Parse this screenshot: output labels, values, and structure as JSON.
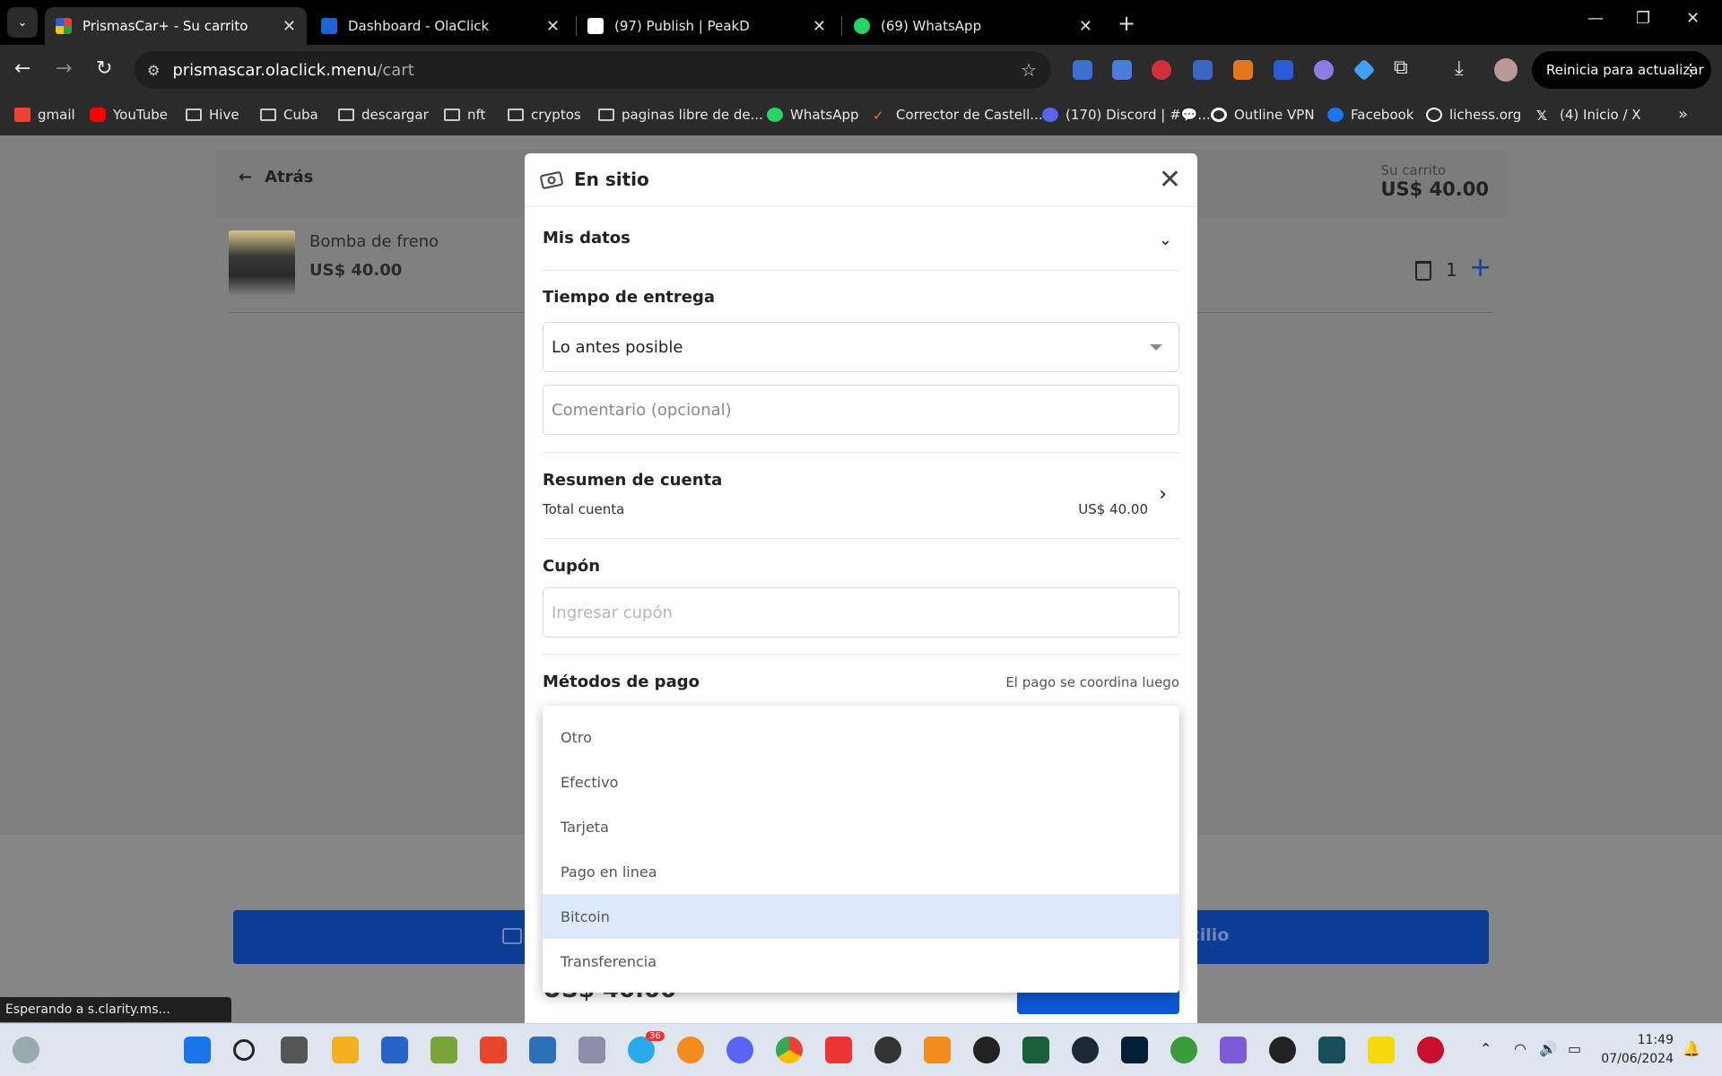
{
  "browser": {
    "tabs": [
      {
        "title": "PrismasCar+ - Su carrito",
        "active": true,
        "favicon_color": "#e0403a"
      },
      {
        "title": "Dashboard - OlaClick",
        "active": false,
        "favicon_color": "#1d64d6"
      },
      {
        "title": "(97) Publish | PeakD",
        "active": false,
        "favicon_color": "#ffffff"
      },
      {
        "title": "(69) WhatsApp",
        "active": false,
        "favicon_color": "#25d366"
      }
    ],
    "url": {
      "host": "prismascar.olaclick.menu",
      "path": "/cart"
    },
    "update_button": "Reinicia para actualizar",
    "bookmarks": [
      {
        "label": "gmail",
        "icon": "gmail-icon",
        "color": "#ea4335"
      },
      {
        "label": "YouTube",
        "icon": "youtube-icon",
        "color": "#ff0000"
      },
      {
        "label": "Hive",
        "icon": "folder-icon"
      },
      {
        "label": "Cuba",
        "icon": "folder-icon"
      },
      {
        "label": "descargar",
        "icon": "folder-icon"
      },
      {
        "label": "nft",
        "icon": "folder-icon"
      },
      {
        "label": "cryptos",
        "icon": "folder-icon"
      },
      {
        "label": "paginas libre de de...",
        "icon": "folder-icon"
      },
      {
        "label": "WhatsApp",
        "icon": "whatsapp-icon",
        "color": "#25d366"
      },
      {
        "label": "Corrector de Castell...",
        "icon": "check-icon",
        "color": "#f36b21"
      },
      {
        "label": "(170) Discord | #💬...",
        "icon": "discord-icon",
        "color": "#5865f2"
      },
      {
        "label": "Outline VPN",
        "icon": "outline-icon",
        "color": "#ffffff"
      },
      {
        "label": "Facebook",
        "icon": "facebook-icon",
        "color": "#1877f2"
      },
      {
        "label": "lichess.org",
        "icon": "lichess-icon",
        "color": "#ffffff"
      },
      {
        "label": "(4) Inicio / X",
        "icon": "x-icon",
        "color": "#ffffff"
      }
    ]
  },
  "page": {
    "back_label": "Atrás",
    "cart_label": "Su carrito",
    "cart_total": "US$ 40.00",
    "item": {
      "name": "Bomba de freno",
      "price": "US$ 40.00",
      "qty": "1"
    },
    "bottom_button_text": "icilio"
  },
  "modal": {
    "title": "En sitio",
    "mis_datos": "Mis datos",
    "tiempo_entrega": "Tiempo de entrega",
    "tiempo_value": "Lo antes posible",
    "comment_placeholder": "Comentario (opcional)",
    "resumen": "Resumen de cuenta",
    "total_label": "Total cuenta",
    "total_value": "US$ 40.00",
    "cupon": "Cupón",
    "cupon_placeholder": "Ingresar cupón",
    "metodos": "Métodos de pago",
    "metodos_note": "El pago se coordina luego",
    "footer_total": "US$ 40.00"
  },
  "payment_options": [
    {
      "label": "Otro",
      "selected": false
    },
    {
      "label": "Efectivo",
      "selected": false
    },
    {
      "label": "Tarjeta",
      "selected": false
    },
    {
      "label": "Pago en linea",
      "selected": false
    },
    {
      "label": "Bitcoin",
      "selected": true
    },
    {
      "label": "Transferencia",
      "selected": false
    }
  ],
  "status": "Esperando a s.clarity.ms...",
  "taskbar": {
    "time": "11:49",
    "date": "07/06/2024",
    "telegram_badge": "36"
  }
}
